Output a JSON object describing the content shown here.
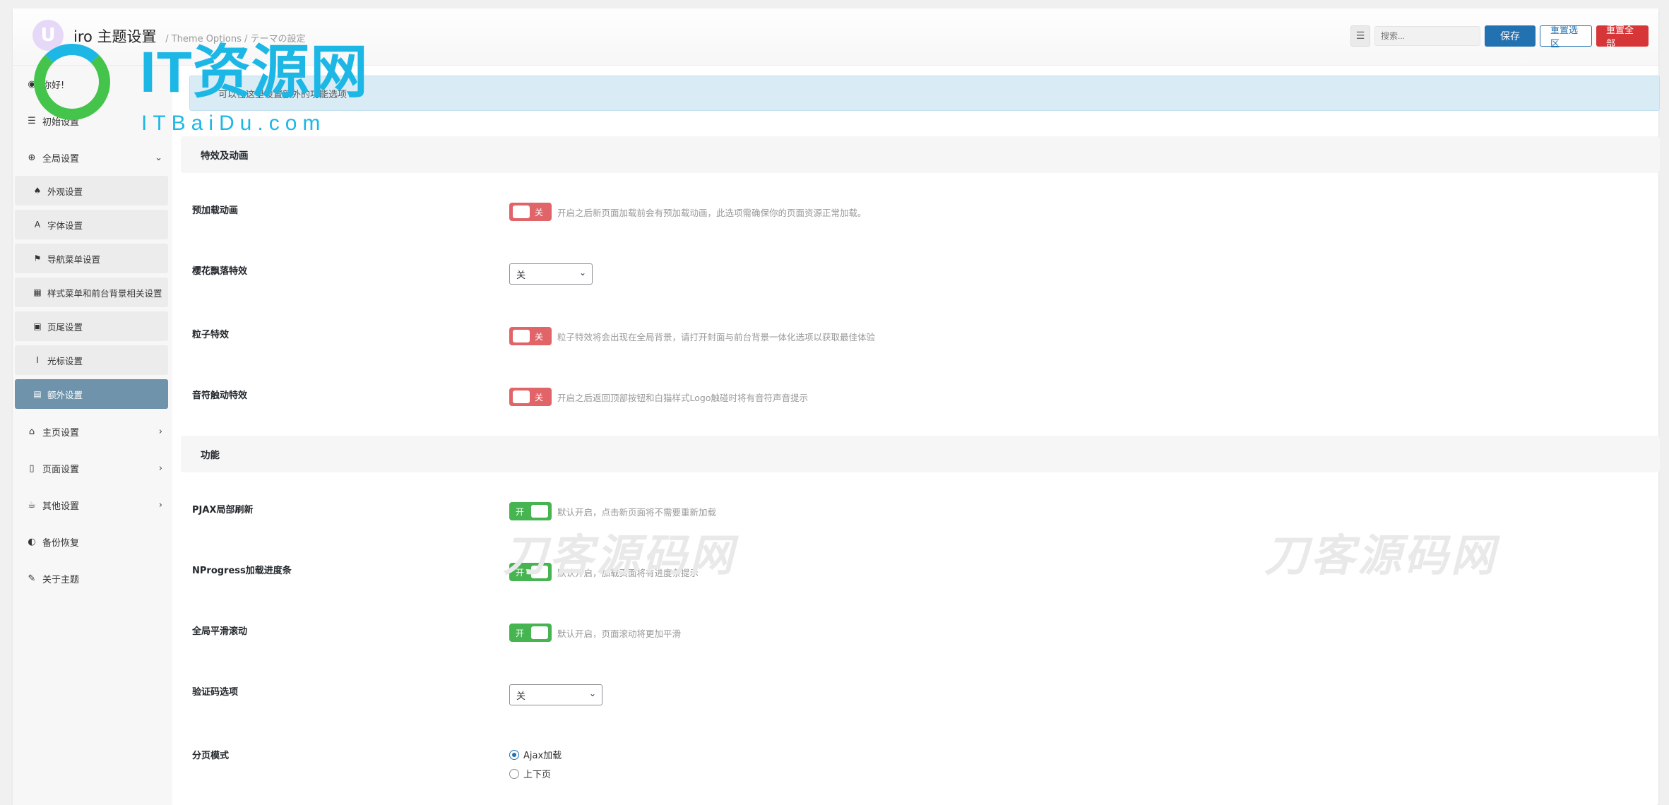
{
  "header": {
    "logo_char": "U",
    "title": "iro 主题设置",
    "subtitle": "/ Theme Options / テーマの設定",
    "expand_glyph": "☰",
    "search_placeholder": "搜索...",
    "save_label": "保存",
    "reset_section_label": "重置选区",
    "reset_all_label": "重置全部"
  },
  "sidebar": {
    "items_top": [
      {
        "icon": "palette-icon",
        "glyph": "◉",
        "label": "你好!"
      },
      {
        "icon": "sliders-icon",
        "glyph": "☰",
        "label": "初始设置"
      },
      {
        "icon": "globe-icon",
        "glyph": "⊕",
        "label": "全局设置",
        "chevron": "⌄"
      }
    ],
    "sub_items": [
      {
        "icon": "tree-icon",
        "glyph": "♠",
        "label": "外观设置"
      },
      {
        "icon": "font-icon",
        "glyph": "A",
        "label": "字体设置"
      },
      {
        "icon": "signpost-icon",
        "glyph": "⚑",
        "label": "导航菜单设置"
      },
      {
        "icon": "grid-icon",
        "glyph": "▦",
        "label": "样式菜单和前台背景相关设置"
      },
      {
        "icon": "footer-icon",
        "glyph": "▣",
        "label": "页尾设置"
      },
      {
        "icon": "cursor-icon",
        "glyph": "I",
        "label": "光标设置"
      },
      {
        "icon": "gift-icon",
        "glyph": "▤",
        "label": "额外设置",
        "active": true
      }
    ],
    "items_bottom": [
      {
        "icon": "home-icon",
        "glyph": "⌂",
        "label": "主页设置",
        "chevron": "›"
      },
      {
        "icon": "file-icon",
        "glyph": "▯",
        "label": "页面设置",
        "chevron": "›"
      },
      {
        "icon": "coffee-icon",
        "glyph": "☕",
        "label": "其他设置",
        "chevron": "›"
      },
      {
        "icon": "shield-icon",
        "glyph": "◐",
        "label": "备份恢复"
      },
      {
        "icon": "paperclip-icon",
        "glyph": "✎",
        "label": "关于主题"
      }
    ]
  },
  "notice": "可以在这里设置额外的功能选项",
  "sections": {
    "effects": "特效及动画",
    "features": "功能"
  },
  "rows": {
    "preload": {
      "label": "预加载动画",
      "state": "关",
      "desc": "开启之后新页面加载前会有预加载动画，此选项需确保你的页面资源正常加载。"
    },
    "sakura": {
      "label": "樱花飘落特效",
      "value": "关",
      "arrow": "⌄"
    },
    "particles": {
      "label": "粒子特效",
      "state": "关",
      "desc": "粒子特效将会出现在全局背景，请打开封面与前台背景一体化选项以获取最佳体验"
    },
    "music_touch": {
      "label": "音符触动特效",
      "state": "关",
      "desc": "开启之后返回顶部按钮和白猫样式Logo触碰时将有音符声音提示"
    },
    "pjax": {
      "label": "PJAX局部刷新",
      "state": "开",
      "desc": "默认开启，点击新页面将不需要重新加载"
    },
    "nprogress": {
      "label": "NProgress加载进度条",
      "state": "开",
      "desc": "默认开启，加载页面将有进度条提示"
    },
    "smooth_scroll": {
      "label": "全局平滑滚动",
      "state": "开",
      "desc": "默认开启，页面滚动将更加平滑"
    },
    "captcha": {
      "label": "验证码选项",
      "value": "关",
      "arrow": "⌄"
    },
    "pagination": {
      "label": "分页模式",
      "options": [
        "Ajax加载",
        "上下页"
      ],
      "selected": 0
    }
  },
  "watermarks": {
    "logo_text": "IT资源网",
    "logo_sub": "ITBaiDu.com",
    "faint_text": "刀客源码网"
  },
  "colors": {
    "primary": "#2271b1",
    "danger": "#d63638",
    "toggle_on": "#46b450",
    "toggle_off": "#e06468",
    "active_nav": "#6f93aa",
    "notice_bg": "#d9ecf6"
  }
}
